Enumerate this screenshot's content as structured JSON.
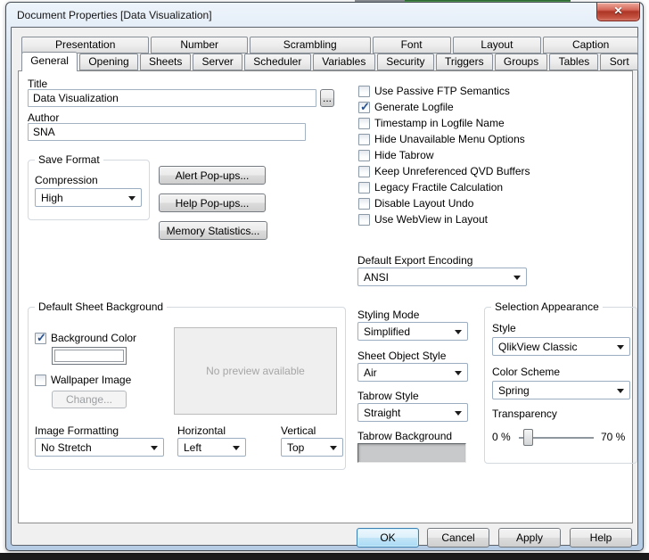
{
  "window": {
    "title": "Document Properties [Data Visualization]"
  },
  "icons": {
    "close": "✕",
    "check": "✓",
    "browse": "..."
  },
  "colors": {
    "frame_blue": "#b6cce5",
    "close_red": "#c24e3d",
    "default_button_border": "#3c7fb1",
    "check_mark": "#26508e",
    "background_swatch": "#ffffff",
    "tabrow_swatch": "#c7c9cb"
  },
  "tabs": {
    "row1": [
      "Presentation",
      "Number",
      "Scrambling",
      "Font",
      "Layout",
      "Caption"
    ],
    "row2": [
      "General",
      "Opening",
      "Sheets",
      "Server",
      "Scheduler",
      "Variables",
      "Security",
      "Triggers",
      "Groups",
      "Tables",
      "Sort"
    ],
    "active": "General"
  },
  "general": {
    "title_label": "Title",
    "title_value": "Data Visualization",
    "browse_label": "...",
    "author_label": "Author",
    "author_value": "SNA",
    "save_format": {
      "legend": "Save Format",
      "compression_label": "Compression",
      "compression_value": "High"
    },
    "action_buttons": {
      "alert": "Alert Pop-ups...",
      "help": "Help Pop-ups...",
      "memory": "Memory Statistics..."
    },
    "checkboxes": [
      {
        "label": "Use Passive FTP Semantics",
        "checked": false
      },
      {
        "label": "Generate Logfile",
        "checked": true
      },
      {
        "label": "Timestamp in Logfile Name",
        "checked": false
      },
      {
        "label": "Hide Unavailable Menu Options",
        "checked": false
      },
      {
        "label": "Hide Tabrow",
        "checked": false
      },
      {
        "label": "Keep Unreferenced QVD Buffers",
        "checked": false
      },
      {
        "label": "Legacy Fractile Calculation",
        "checked": false
      },
      {
        "label": "Disable Layout Undo",
        "checked": false
      },
      {
        "label": "Use WebView in Layout",
        "checked": false
      }
    ],
    "export_encoding": {
      "label": "Default Export Encoding",
      "value": "ANSI"
    },
    "sheet_background": {
      "legend": "Default Sheet Background",
      "background_color_label": "Background Color",
      "background_color_checked": true,
      "swatch_color": "#ffffff",
      "wallpaper_label": "Wallpaper Image",
      "wallpaper_checked": false,
      "change_label": "Change...",
      "preview_text": "No preview available",
      "image_formatting_label": "Image Formatting",
      "image_formatting_value": "No Stretch",
      "horizontal_label": "Horizontal",
      "horizontal_value": "Left",
      "vertical_label": "Vertical",
      "vertical_value": "Top"
    },
    "styling": {
      "styling_mode_label": "Styling Mode",
      "styling_mode_value": "Simplified",
      "sheet_object_style_label": "Sheet Object Style",
      "sheet_object_style_value": "Air",
      "tabrow_style_label": "Tabrow Style",
      "tabrow_style_value": "Straight",
      "tabrow_background_label": "Tabrow Background",
      "tabrow_background_color": "#c7c9cb"
    },
    "selection_appearance": {
      "legend": "Selection Appearance",
      "style_label": "Style",
      "style_value": "QlikView Classic",
      "color_scheme_label": "Color Scheme",
      "color_scheme_value": "Spring",
      "transparency_label": "Transparency",
      "min_label": "0 %",
      "max_label": "70 %",
      "slider_pos_pct": 6
    }
  },
  "footer": {
    "ok": "OK",
    "cancel": "Cancel",
    "apply": "Apply",
    "help": "Help"
  }
}
